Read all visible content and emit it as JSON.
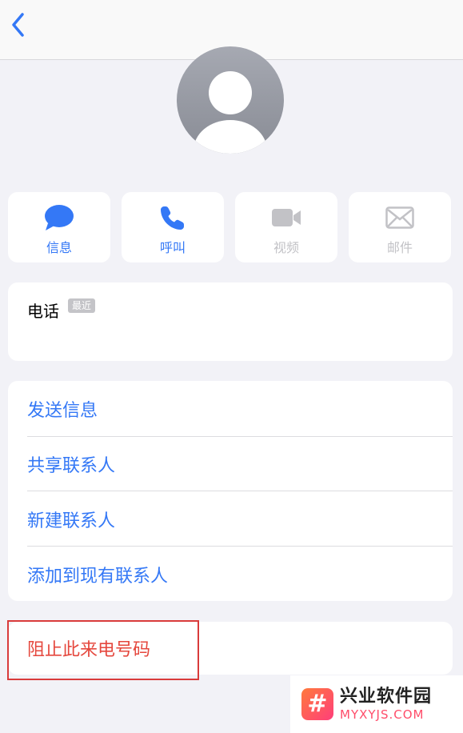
{
  "actions": {
    "message": "信息",
    "call": "呼叫",
    "video": "视频",
    "mail": "邮件"
  },
  "phone_section": {
    "title": "电话",
    "badge": "最近"
  },
  "menu": {
    "items": [
      "发送信息",
      "共享联系人",
      "新建联系人",
      "添加到现有联系人"
    ]
  },
  "block": {
    "label": "阻止此来电号码"
  },
  "watermark": {
    "logo_glyph": "#",
    "title": "兴业软件园",
    "site": "MYXYJS.COM"
  },
  "colors": {
    "accent": "#3478f6",
    "destructive": "#e5473d",
    "disabled": "#c2c2c6",
    "background": "#f2f2f7"
  }
}
